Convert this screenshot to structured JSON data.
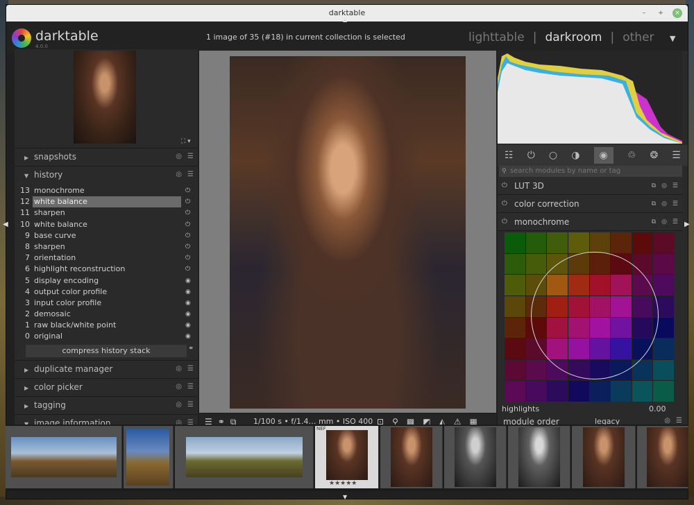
{
  "window": {
    "title": "darktable",
    "btn_min": "–",
    "btn_max": "+",
    "btn_close": "×"
  },
  "app": {
    "name": "darktable",
    "version": "4.0.0"
  },
  "status": "1 image of 35 (#18) in current collection is selected",
  "views": {
    "lighttable": "lighttable",
    "darkroom": "darkroom",
    "other": "other",
    "sep": "|",
    "dropdown": "▼"
  },
  "left_panel": {
    "thumb_controls": "⛶ ▾",
    "sections": [
      {
        "label": "snapshots",
        "expanded": false
      },
      {
        "label": "history",
        "expanded": true
      },
      {
        "label": "duplicate manager",
        "expanded": false
      },
      {
        "label": "color picker",
        "expanded": false
      },
      {
        "label": "tagging",
        "expanded": false
      },
      {
        "label": "image information",
        "expanded": true
      }
    ],
    "history": [
      {
        "num": "13",
        "name": "monochrome",
        "icon": "⏻"
      },
      {
        "num": "12",
        "name": "white balance",
        "icon": "⏻",
        "selected": true
      },
      {
        "num": "11",
        "name": "sharpen",
        "icon": "⏻"
      },
      {
        "num": "10",
        "name": "white balance",
        "icon": "⏻"
      },
      {
        "num": "9",
        "name": "base curve",
        "icon": "⏻"
      },
      {
        "num": "8",
        "name": "sharpen",
        "icon": "⏻"
      },
      {
        "num": "7",
        "name": "orientation",
        "icon": "⏻"
      },
      {
        "num": "6",
        "name": "highlight reconstruction",
        "icon": "⏻"
      },
      {
        "num": "5",
        "name": "display encoding",
        "icon": "◉"
      },
      {
        "num": "4",
        "name": "output color profile",
        "icon": "◉"
      },
      {
        "num": "3",
        "name": "input color profile",
        "icon": "◉"
      },
      {
        "num": "2",
        "name": "demosaic",
        "icon": "◉"
      },
      {
        "num": "1",
        "name": "raw black/white point",
        "icon": "◉"
      },
      {
        "num": "0",
        "name": "original",
        "icon": "◉"
      }
    ],
    "compress_label": "compress history stack"
  },
  "center_toolbar": {
    "exif": "1/100 s • f/1.4… mm • ISO 400"
  },
  "right_panel": {
    "search_placeholder": "search modules by name or tag",
    "modules": [
      "LUT 3D",
      "color correction",
      "monochrome"
    ],
    "highlights_label": "highlights",
    "highlights_value": "0.00",
    "module_order_label": "module order",
    "module_order_value": "legacy"
  },
  "filmstrip": {
    "selected_badge": "NEF",
    "selected_stars": "★★★★★"
  },
  "colors": {
    "accent_selected": "#6b6b6b",
    "panel_bg": "#2a2a2a",
    "center_bg": "#7e7e7e"
  }
}
